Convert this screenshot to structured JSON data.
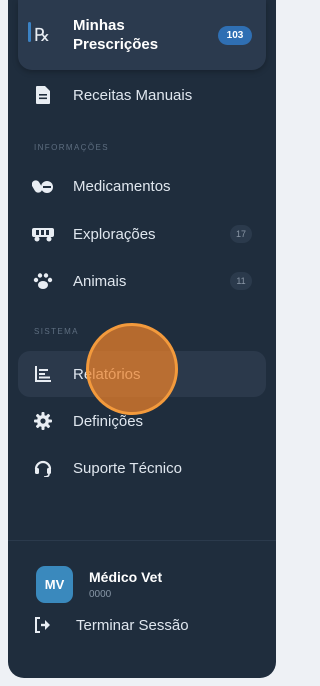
{
  "nav_top": {
    "label": "Minhas Prescrições",
    "label_line1": "Minhas",
    "label_line2": "Prescrições",
    "badge": "103",
    "icon": "prescription-rx-icon"
  },
  "nav_items_main": [
    {
      "label": "Receitas Manuais",
      "icon": "document-icon"
    }
  ],
  "section_info": "INFORMAÇÕES",
  "nav_items_info": [
    {
      "label": "Medicamentos",
      "icon": "pills-icon",
      "badge": ""
    },
    {
      "label": "Explorações",
      "icon": "truck-icon",
      "badge": "17"
    },
    {
      "label": "Animais",
      "icon": "paw-icon",
      "badge": "11"
    }
  ],
  "section_system": "SISTEMA",
  "nav_items_system": [
    {
      "label": "Relatórios",
      "icon": "chart-bars-icon"
    },
    {
      "label": "Definições",
      "icon": "gear-icon"
    },
    {
      "label": "Suporte Técnico",
      "icon": "headset-icon"
    }
  ],
  "user": {
    "initials": "MV",
    "name": "Médico Vet",
    "id": "0000"
  },
  "logout_label": "Terminar Sessão",
  "colors": {
    "sidebar_bg": "#1f2d3d",
    "accent": "#3b82c4",
    "cursor": "#f39a3c"
  }
}
